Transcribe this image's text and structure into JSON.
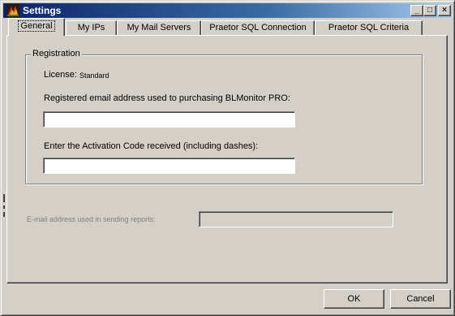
{
  "window": {
    "title": "Settings",
    "icon": "app-icon",
    "caption_buttons": {
      "minimize": "_",
      "maximize": "□",
      "close": "×"
    }
  },
  "tabs": [
    {
      "label": "General",
      "active": true
    },
    {
      "label": "My IPs",
      "active": false
    },
    {
      "label": "My Mail Servers",
      "active": false
    },
    {
      "label": "Praetor SQL Connection",
      "active": false
    },
    {
      "label": "Praetor SQL Criteria",
      "active": false
    }
  ],
  "registration": {
    "group_title": "Registration",
    "license_label": "License:",
    "license_value": "Standard",
    "email_label": "Registered email address used to purchasing BLMonitor PRO:",
    "email_value": "",
    "activation_label": "Enter the Activation Code received (including dashes):",
    "activation_value": ""
  },
  "reports": {
    "email_label": "E-mail address used in sending reports:",
    "email_value": ""
  },
  "buttons": {
    "ok": "OK",
    "cancel": "Cancel"
  },
  "colors": {
    "face": "#d4d0c8",
    "title_gradient_start": "#0a246a",
    "title_gradient_end": "#a6caf0",
    "disabled_text": "#808080"
  }
}
